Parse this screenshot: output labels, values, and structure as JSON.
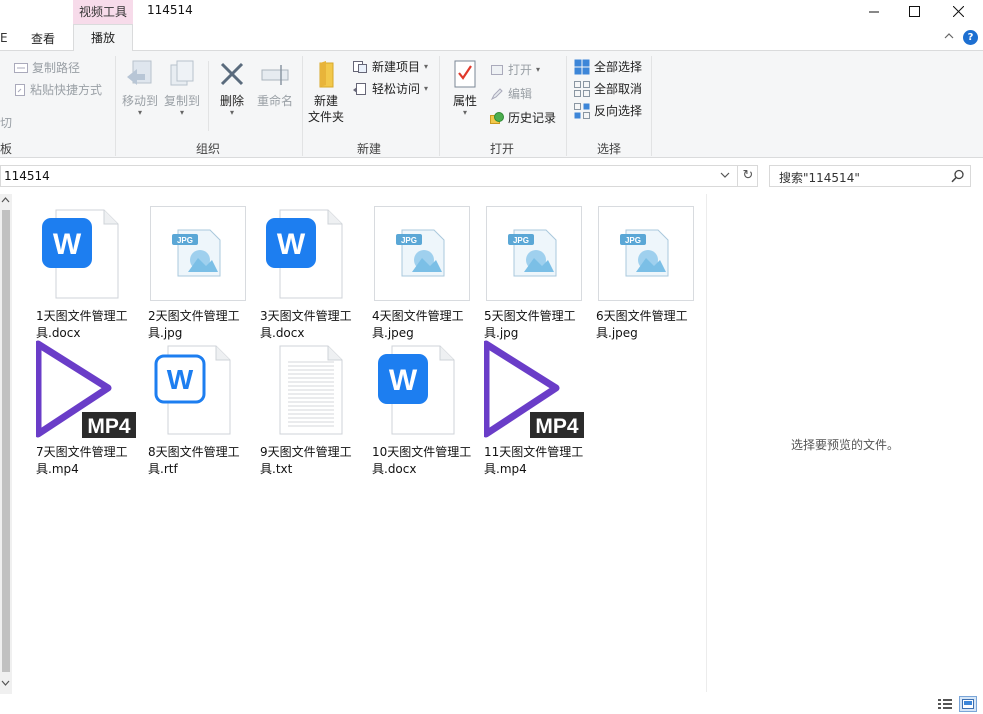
{
  "window": {
    "title": "114514",
    "context_tab": "视频工具",
    "min_label": "—",
    "max_label": "☐",
    "close_label": "✕"
  },
  "tabs": {
    "cut_fragment": "E",
    "view": "查看",
    "play": "播放",
    "help": "?"
  },
  "ribbon": {
    "clipboard": {
      "copy_path": "复制路径",
      "paste_shortcut": "粘贴快捷方式",
      "cut_fragment": "切",
      "group_fragment": "板"
    },
    "organize": {
      "move_to": "移动到",
      "copy_to": "复制到",
      "delete": "删除",
      "rename": "重命名",
      "group": "组织"
    },
    "new": {
      "new_folder_line1": "新建",
      "new_folder_line2": "文件夹",
      "new_item": "新建项目",
      "easy_access": "轻松访问",
      "group": "新建"
    },
    "open": {
      "properties": "属性",
      "open": "打开",
      "edit": "编辑",
      "history": "历史记录",
      "group": "打开"
    },
    "select": {
      "select_all": "全部选择",
      "select_none": "全部取消",
      "invert": "反向选择",
      "group": "选择"
    }
  },
  "address": {
    "path": "114514",
    "search_placeholder": "搜索\"114514\""
  },
  "files": [
    {
      "name": "1天图文件管理工具.docx",
      "type": "docx"
    },
    {
      "name": "2天图文件管理工具.jpg",
      "type": "jpg"
    },
    {
      "name": "3天图文件管理工具.docx",
      "type": "docx"
    },
    {
      "name": "4天图文件管理工具.jpeg",
      "type": "jpg"
    },
    {
      "name": "5天图文件管理工具.jpg",
      "type": "jpg"
    },
    {
      "name": "6天图文件管理工具.jpeg",
      "type": "jpg"
    },
    {
      "name": "7天图文件管理工具.mp4",
      "type": "mp4"
    },
    {
      "name": "8天图文件管理工具.rtf",
      "type": "rtf"
    },
    {
      "name": "9天图文件管理工具.txt",
      "type": "txt"
    },
    {
      "name": "10天图文件管理工具.docx",
      "type": "docx"
    },
    {
      "name": "11天图文件管理工具.mp4",
      "type": "mp4"
    }
  ],
  "icon_text": {
    "jpg_badge": "JPG",
    "mp4_badge": "MP4",
    "w_letter": "W"
  },
  "preview": {
    "message": "选择要预览的文件。"
  },
  "colors": {
    "word_blue": "#1d7ef0",
    "mp4_purple": "#6a3dc8",
    "context_tab_pink": "#f7dbea",
    "help_blue": "#1d6fd1"
  }
}
